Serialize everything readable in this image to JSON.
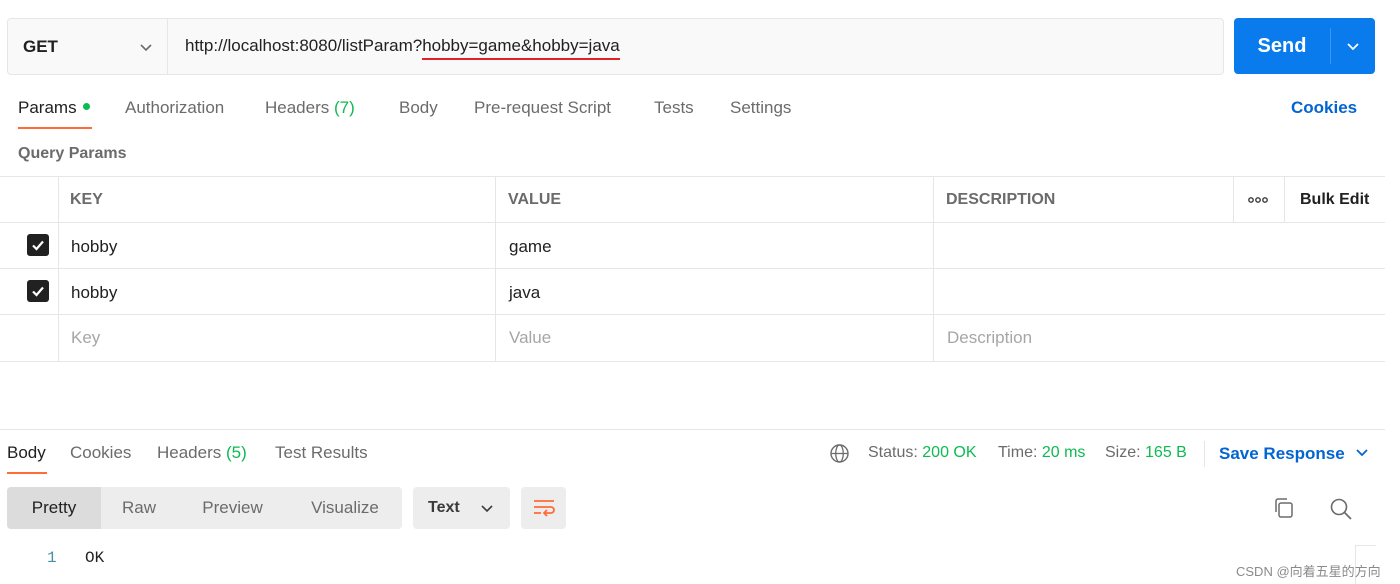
{
  "request": {
    "method": "GET",
    "url_prefix": "http://localhost:8080/listParam?",
    "url_query": "hobby=game&hobby=java",
    "send_label": "Send"
  },
  "tabs": {
    "params": "Params",
    "authorization": "Authorization",
    "headers": "Headers",
    "headers_count": "(7)",
    "body": "Body",
    "prerequest": "Pre-request Script",
    "tests": "Tests",
    "settings": "Settings",
    "cookies": "Cookies"
  },
  "query_params": {
    "title": "Query Params",
    "columns": {
      "key": "KEY",
      "value": "VALUE",
      "description": "DESCRIPTION",
      "bulk_edit": "Bulk Edit"
    },
    "rows": [
      {
        "checked": true,
        "key": "hobby",
        "value": "game",
        "description": ""
      },
      {
        "checked": true,
        "key": "hobby",
        "value": "java",
        "description": ""
      }
    ],
    "placeholders": {
      "key": "Key",
      "value": "Value",
      "description": "Description"
    }
  },
  "response": {
    "tabs": {
      "body": "Body",
      "cookies": "Cookies",
      "headers": "Headers",
      "headers_count": "(5)",
      "test_results": "Test Results"
    },
    "status_label": "Status:",
    "status_value": "200 OK",
    "time_label": "Time:",
    "time_value": "20 ms",
    "size_label": "Size:",
    "size_value": "165 B",
    "save_response": "Save Response",
    "view_modes": [
      "Pretty",
      "Raw",
      "Preview",
      "Visualize"
    ],
    "format": "Text",
    "lines": [
      {
        "number": "1",
        "text": "OK"
      }
    ]
  },
  "watermark": "CSDN @向着五星的方向",
  "colors": {
    "accent": "#ff6c37",
    "send": "#097bed",
    "link": "#0265d2",
    "success": "#0cbb52",
    "url_underline": "#e0202a"
  },
  "icons": [
    "chevron-down-icon",
    "globe-icon",
    "more-icon",
    "checkbox-checked-icon",
    "wrap-lines-icon",
    "copy-icon",
    "search-icon"
  ]
}
